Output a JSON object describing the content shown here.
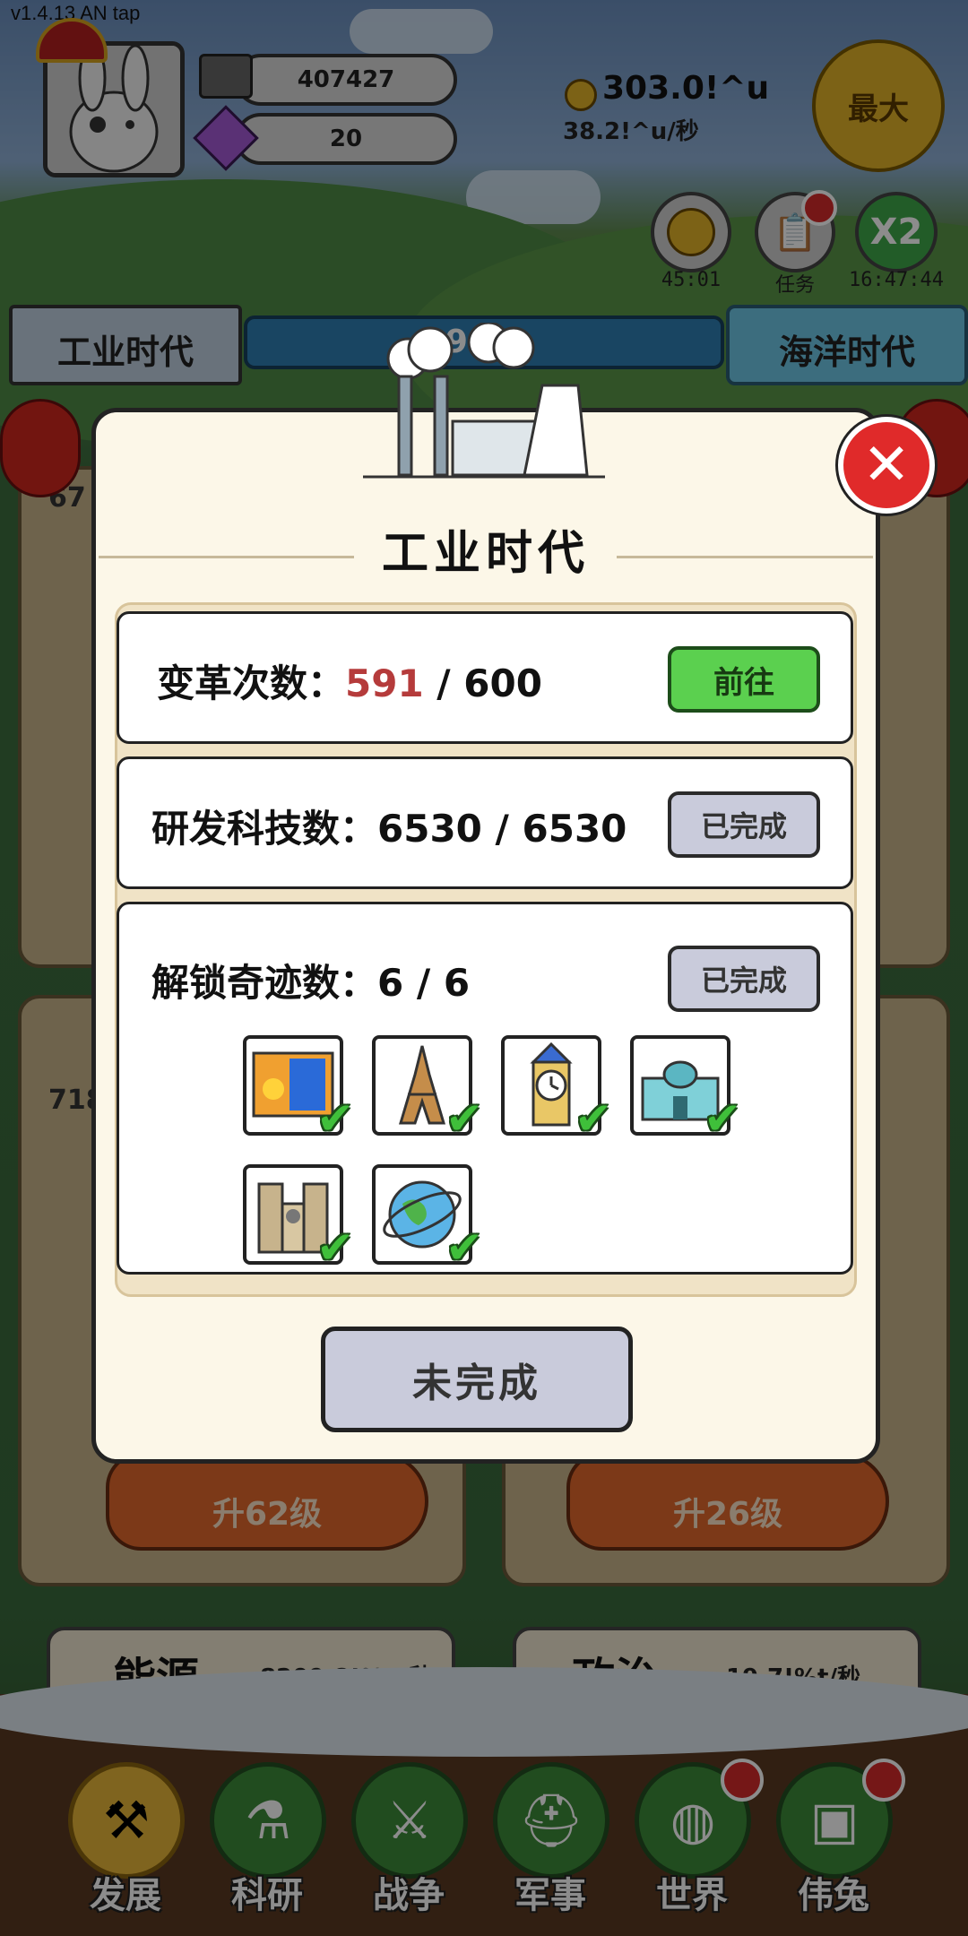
{
  "version": "v1.4.13 AN tap",
  "resources": {
    "iron": "407427",
    "gems": "20"
  },
  "coins": {
    "amount": "303.0!^u",
    "rate": "38.2!^u/秒"
  },
  "max_button": "最大",
  "side_buttons": [
    {
      "name": "coin-bonus",
      "caption": "45:01"
    },
    {
      "name": "tasks",
      "caption": "任务"
    },
    {
      "name": "x2",
      "label": "X2",
      "caption": "16:47:44"
    }
  ],
  "era_bar": {
    "current": "工业时代",
    "progress": "99%",
    "next": "海洋时代"
  },
  "background_texts": {
    "left_value": "67",
    "left_value2": "718",
    "carrot_left": "升62级",
    "carrot_right": "升26级",
    "energy_title": "能源",
    "energy_rate": "8209.8!%g/秒",
    "politics_title": "政治",
    "politics_rate": "19.7!%t/秒"
  },
  "modal": {
    "title": "工业时代",
    "rows": [
      {
        "label": "变革次数：",
        "current": "591",
        "total": " / 600",
        "button": "前往"
      },
      {
        "label": "研发科技数：",
        "value": "6530 / 6530",
        "button": "已完成"
      },
      {
        "label": "解锁奇迹数：",
        "value": "6 / 6",
        "button": "已完成"
      }
    ],
    "wonders": [
      {
        "name": "billboard",
        "icon": "billboard-icon",
        "checked": true
      },
      {
        "name": "eiffel-tower",
        "icon": "eiffel-tower-icon",
        "checked": true
      },
      {
        "name": "big-ben",
        "icon": "clock-tower-icon",
        "checked": true
      },
      {
        "name": "palace",
        "icon": "palace-icon",
        "checked": true
      },
      {
        "name": "notre-dame",
        "icon": "cathedral-icon",
        "checked": true
      },
      {
        "name": "globe",
        "icon": "globe-icon",
        "checked": true
      }
    ],
    "check_mark": "✔",
    "footer_button": "未完成"
  },
  "nav": [
    {
      "label": "发展",
      "icon": "hoe-icon",
      "active": true,
      "badge": false
    },
    {
      "label": "科研",
      "icon": "flask-icon",
      "active": false,
      "badge": false
    },
    {
      "label": "战争",
      "icon": "swords-icon",
      "active": false,
      "badge": false
    },
    {
      "label": "军事",
      "icon": "helmet-icon",
      "active": false,
      "badge": false
    },
    {
      "label": "世界",
      "icon": "globe-icon",
      "active": false,
      "badge": true
    },
    {
      "label": "伟兔",
      "icon": "rabbit-portrait-icon",
      "active": false,
      "badge": true
    }
  ],
  "colors": {
    "go_button": "#5bd04f",
    "done_button": "#c9cbdb",
    "close_button": "#e02a2a",
    "highlight_number": "#b53b3b"
  }
}
